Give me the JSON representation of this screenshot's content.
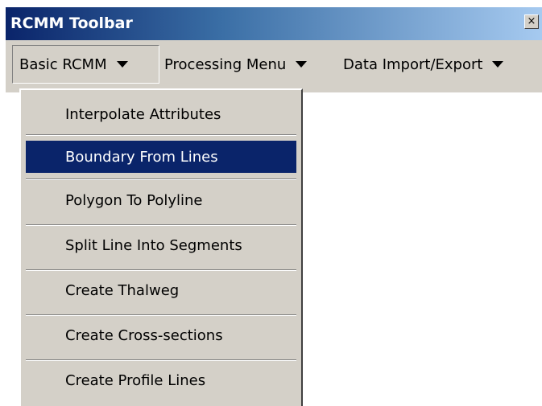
{
  "window": {
    "title": "RCMM Toolbar",
    "close_glyph": "×"
  },
  "menubar": {
    "items": [
      {
        "label": "Basic RCMM"
      },
      {
        "label": "Processing Menu"
      },
      {
        "label": "Data Import/Export"
      }
    ]
  },
  "dropdown": {
    "items": [
      {
        "label": "Interpolate Attributes"
      },
      {
        "label": "Boundary From Lines"
      },
      {
        "label": "Polygon To Polyline"
      },
      {
        "label": "Split Line Into Segments"
      },
      {
        "label": "Create Thalweg"
      },
      {
        "label": "Create Cross-sections"
      },
      {
        "label": "Create Profile Lines"
      }
    ],
    "selected_label": "Boundary From Lines"
  },
  "colors": {
    "titlebar_start": "#0a246a",
    "titlebar_end": "#a6caf0",
    "face": "#d4d0c8",
    "highlight": "#0a246a"
  }
}
